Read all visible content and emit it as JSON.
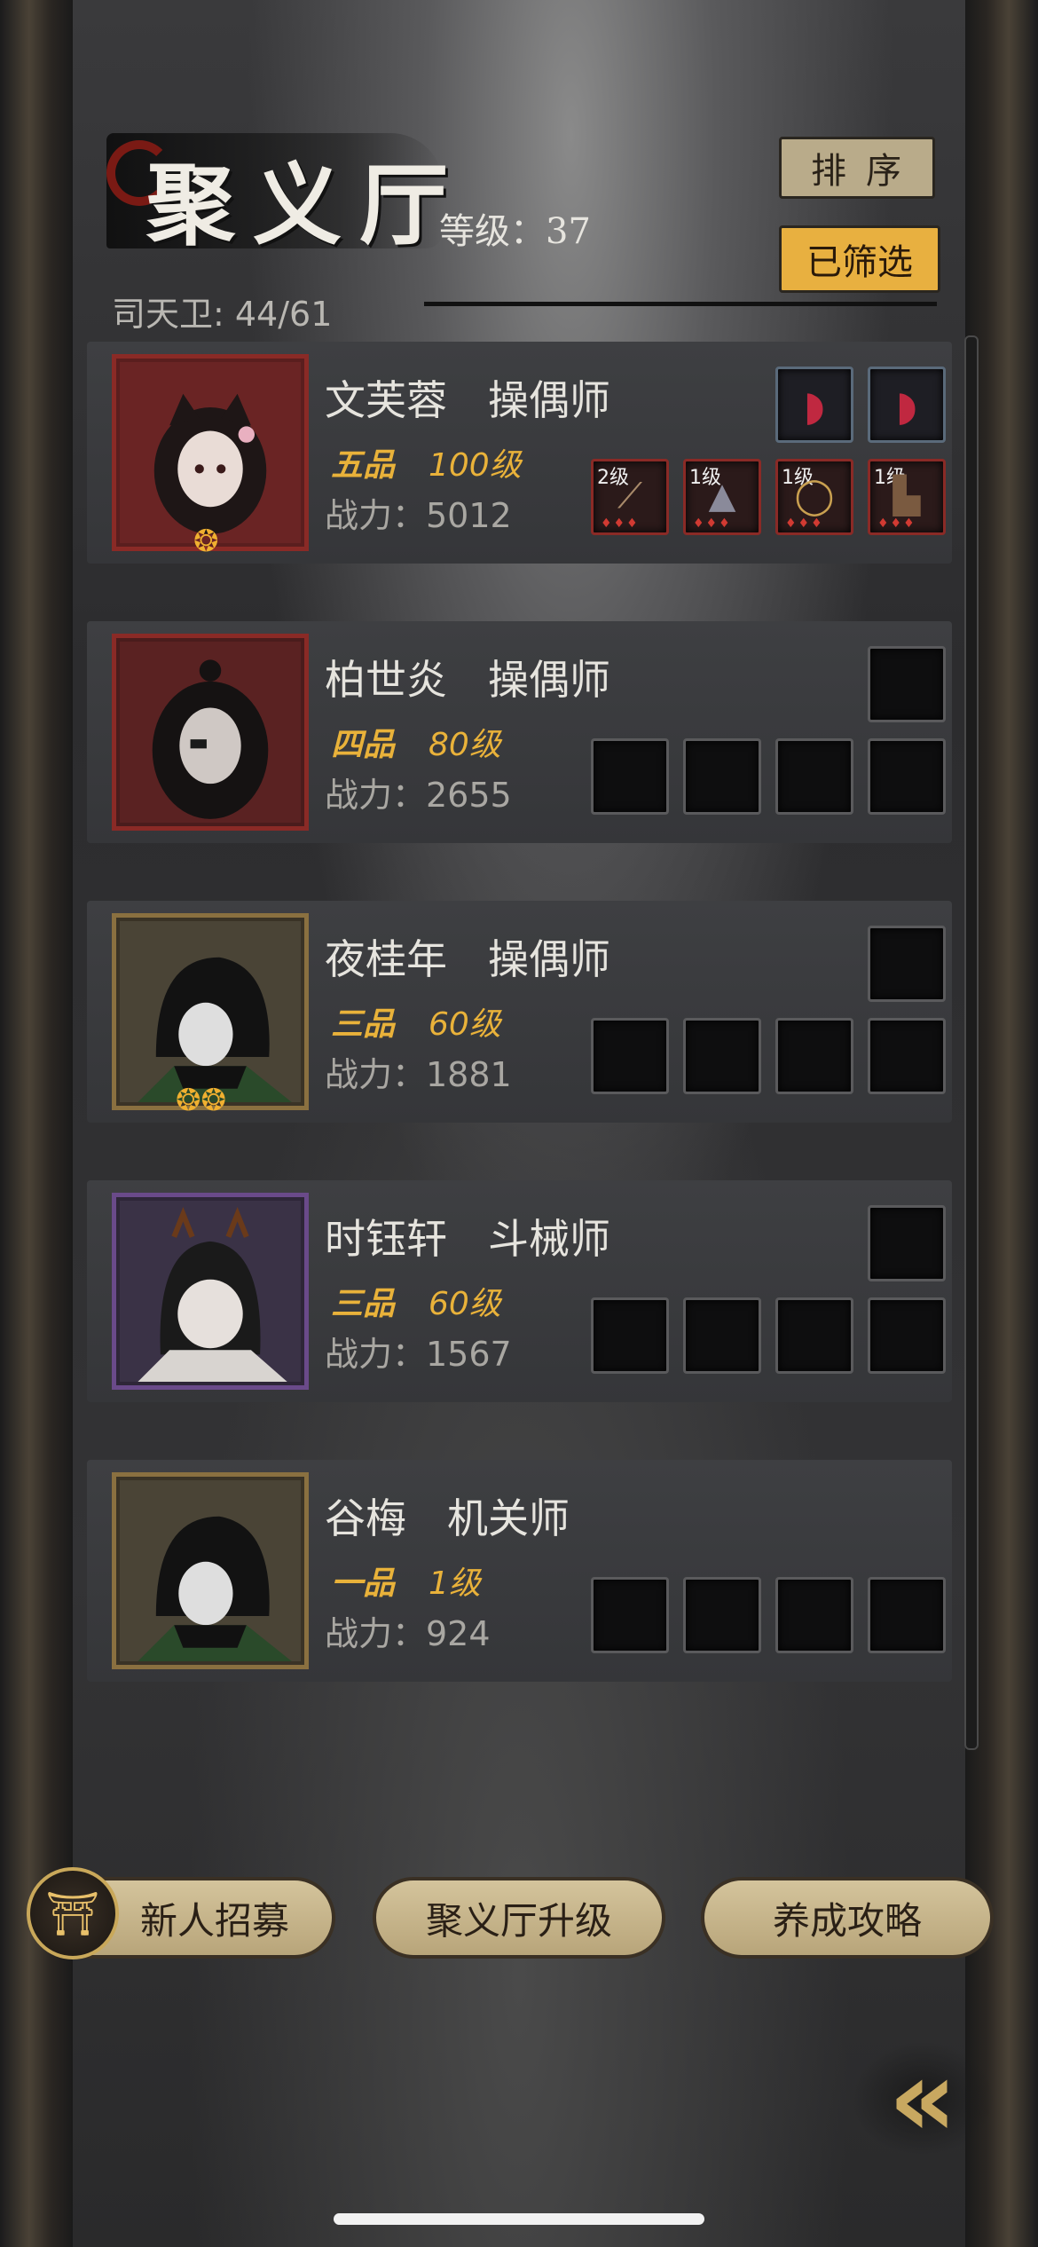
{
  "header": {
    "title": "聚义厅",
    "level_text": "等级：37",
    "member_count": "司天卫: 44/61",
    "sort_label": "排序",
    "filter_label": "已筛选"
  },
  "members": [
    {
      "name": "文芙蓉　操偶师",
      "rank": "五品",
      "level": "100级",
      "power": "战力：5012",
      "equip": [
        {
          "lv": "2级",
          "icon": "crossbow-icon"
        },
        {
          "lv": "1级",
          "icon": "armor-icon"
        },
        {
          "lv": "1级",
          "icon": "ring-icon"
        },
        {
          "lv": "1级",
          "icon": "boots-icon"
        }
      ],
      "badge": "gold-swirl-icon"
    },
    {
      "name": "柏世炎　操偶师",
      "rank": "四品",
      "level": "80级",
      "power": "战力：2655"
    },
    {
      "name": "夜桂年　操偶师",
      "rank": "三品",
      "level": "60级",
      "power": "战力：1881"
    },
    {
      "name": "时钰轩　斗械师",
      "rank": "三品",
      "level": "60级",
      "power": "战力：1567"
    },
    {
      "name": "谷梅　机关师",
      "rank": "一品",
      "level": "1级",
      "power": "战力：924"
    }
  ],
  "buttons": {
    "recruit": "新人招募",
    "upgrade": "聚义厅升级",
    "guide": "养成攻略"
  },
  "colors": {
    "accent_gold": "#e8b040",
    "rank_text": "#e9b23a",
    "frame_red": "#8a2a26",
    "frame_gold": "#8a7040",
    "frame_purple": "#6a4a8a"
  }
}
